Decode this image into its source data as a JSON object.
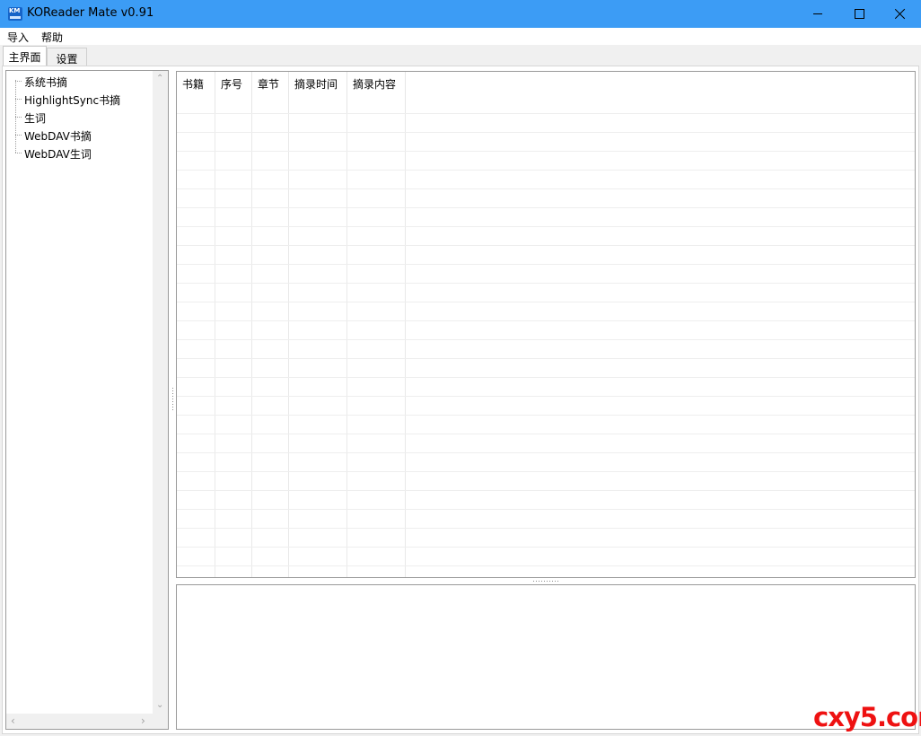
{
  "window": {
    "title": "KOReader Mate v0.91",
    "icon_text": "KM",
    "accent_color": "#3c9cf5"
  },
  "menu": {
    "items": [
      "导入",
      "帮助"
    ]
  },
  "tabs": [
    {
      "label": "主界面",
      "selected": true
    },
    {
      "label": "设置",
      "selected": false
    }
  ],
  "tree": {
    "items": [
      "系统书摘",
      "HighlightSync书摘",
      "生词",
      "WebDAV书摘",
      "WebDAV生词"
    ]
  },
  "table": {
    "columns": [
      "书籍",
      "序号",
      "章节",
      "摘录时间",
      "摘录内容"
    ],
    "rows": []
  },
  "detail": {
    "content": ""
  },
  "watermark": "cxy5.com"
}
